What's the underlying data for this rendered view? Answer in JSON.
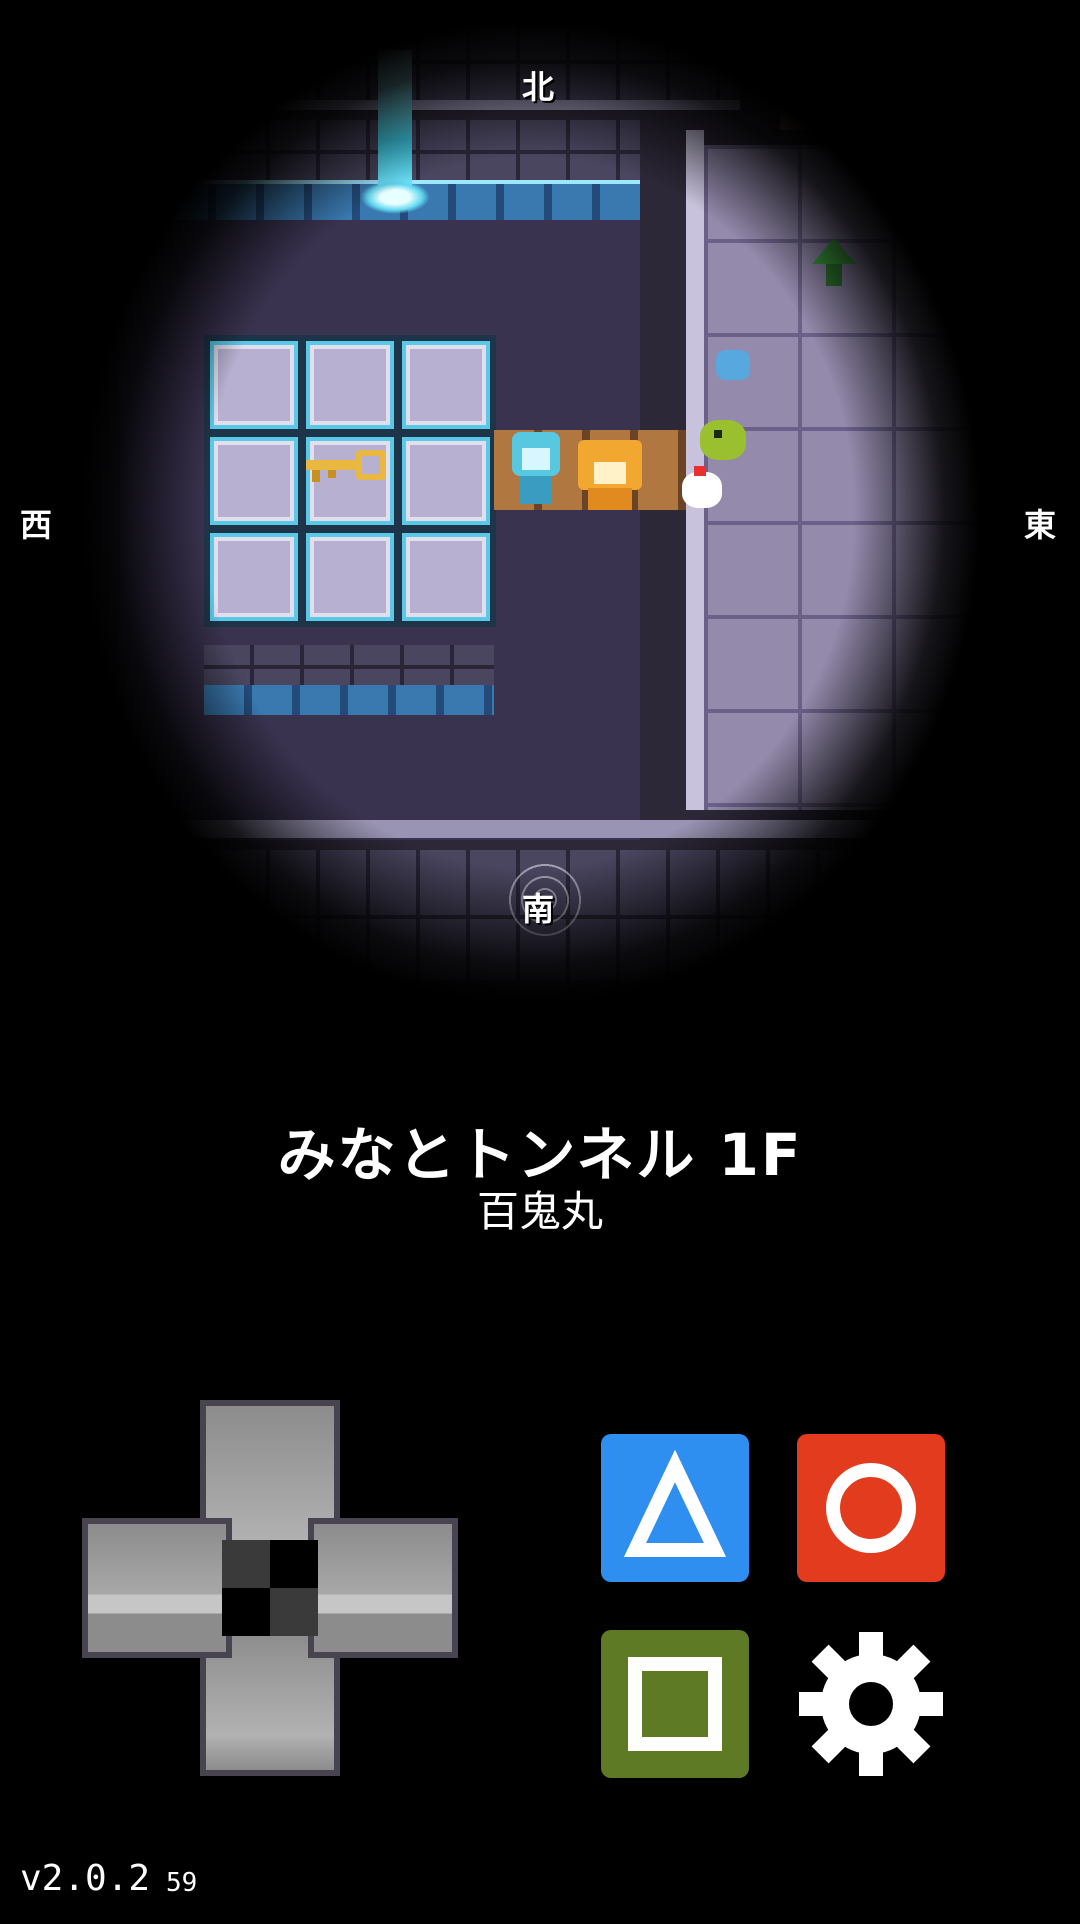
{
  "compass": {
    "north": "北",
    "south": "南",
    "west": "西",
    "east": "東"
  },
  "location": {
    "name": "みなとトンネル 1F",
    "player_name": "百鬼丸"
  },
  "controls": {
    "dpad_icon": "dpad-icon",
    "triangle_icon": "triangle-icon",
    "circle_icon": "circle-icon",
    "square_icon": "square-icon",
    "settings_icon": "gear-icon"
  },
  "colors": {
    "triangle": "#2f8ff0",
    "circle": "#e23b1e",
    "square": "#5f7a25",
    "gear": "#ffffff"
  },
  "footer": {
    "version": "v2.0.2",
    "fps": "59"
  }
}
